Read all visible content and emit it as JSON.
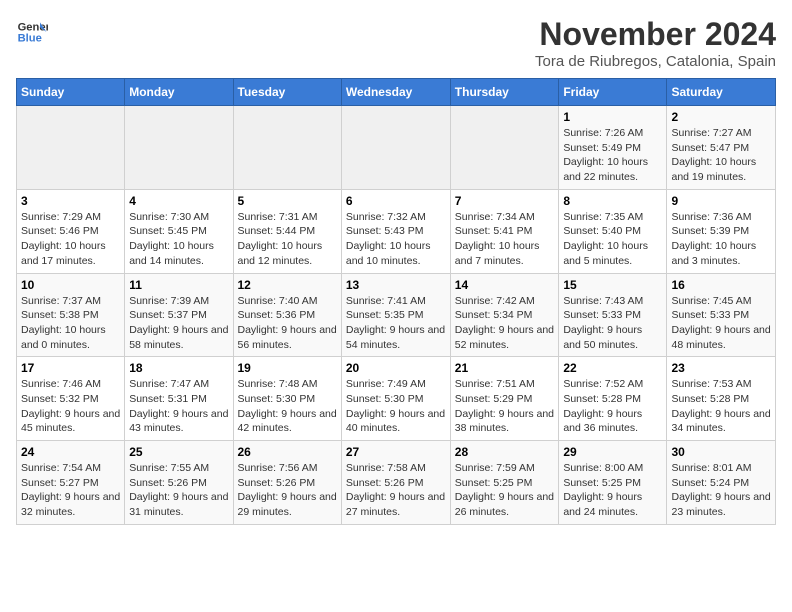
{
  "logo": {
    "line1": "General",
    "line2": "Blue"
  },
  "title": "November 2024",
  "location": "Tora de Riubregos, Catalonia, Spain",
  "weekdays": [
    "Sunday",
    "Monday",
    "Tuesday",
    "Wednesday",
    "Thursday",
    "Friday",
    "Saturday"
  ],
  "weeks": [
    [
      {
        "day": "",
        "info": ""
      },
      {
        "day": "",
        "info": ""
      },
      {
        "day": "",
        "info": ""
      },
      {
        "day": "",
        "info": ""
      },
      {
        "day": "",
        "info": ""
      },
      {
        "day": "1",
        "info": "Sunrise: 7:26 AM\nSunset: 5:49 PM\nDaylight: 10 hours and 22 minutes."
      },
      {
        "day": "2",
        "info": "Sunrise: 7:27 AM\nSunset: 5:47 PM\nDaylight: 10 hours and 19 minutes."
      }
    ],
    [
      {
        "day": "3",
        "info": "Sunrise: 7:29 AM\nSunset: 5:46 PM\nDaylight: 10 hours and 17 minutes."
      },
      {
        "day": "4",
        "info": "Sunrise: 7:30 AM\nSunset: 5:45 PM\nDaylight: 10 hours and 14 minutes."
      },
      {
        "day": "5",
        "info": "Sunrise: 7:31 AM\nSunset: 5:44 PM\nDaylight: 10 hours and 12 minutes."
      },
      {
        "day": "6",
        "info": "Sunrise: 7:32 AM\nSunset: 5:43 PM\nDaylight: 10 hours and 10 minutes."
      },
      {
        "day": "7",
        "info": "Sunrise: 7:34 AM\nSunset: 5:41 PM\nDaylight: 10 hours and 7 minutes."
      },
      {
        "day": "8",
        "info": "Sunrise: 7:35 AM\nSunset: 5:40 PM\nDaylight: 10 hours and 5 minutes."
      },
      {
        "day": "9",
        "info": "Sunrise: 7:36 AM\nSunset: 5:39 PM\nDaylight: 10 hours and 3 minutes."
      }
    ],
    [
      {
        "day": "10",
        "info": "Sunrise: 7:37 AM\nSunset: 5:38 PM\nDaylight: 10 hours and 0 minutes."
      },
      {
        "day": "11",
        "info": "Sunrise: 7:39 AM\nSunset: 5:37 PM\nDaylight: 9 hours and 58 minutes."
      },
      {
        "day": "12",
        "info": "Sunrise: 7:40 AM\nSunset: 5:36 PM\nDaylight: 9 hours and 56 minutes."
      },
      {
        "day": "13",
        "info": "Sunrise: 7:41 AM\nSunset: 5:35 PM\nDaylight: 9 hours and 54 minutes."
      },
      {
        "day": "14",
        "info": "Sunrise: 7:42 AM\nSunset: 5:34 PM\nDaylight: 9 hours and 52 minutes."
      },
      {
        "day": "15",
        "info": "Sunrise: 7:43 AM\nSunset: 5:33 PM\nDaylight: 9 hours and 50 minutes."
      },
      {
        "day": "16",
        "info": "Sunrise: 7:45 AM\nSunset: 5:33 PM\nDaylight: 9 hours and 48 minutes."
      }
    ],
    [
      {
        "day": "17",
        "info": "Sunrise: 7:46 AM\nSunset: 5:32 PM\nDaylight: 9 hours and 45 minutes."
      },
      {
        "day": "18",
        "info": "Sunrise: 7:47 AM\nSunset: 5:31 PM\nDaylight: 9 hours and 43 minutes."
      },
      {
        "day": "19",
        "info": "Sunrise: 7:48 AM\nSunset: 5:30 PM\nDaylight: 9 hours and 42 minutes."
      },
      {
        "day": "20",
        "info": "Sunrise: 7:49 AM\nSunset: 5:30 PM\nDaylight: 9 hours and 40 minutes."
      },
      {
        "day": "21",
        "info": "Sunrise: 7:51 AM\nSunset: 5:29 PM\nDaylight: 9 hours and 38 minutes."
      },
      {
        "day": "22",
        "info": "Sunrise: 7:52 AM\nSunset: 5:28 PM\nDaylight: 9 hours and 36 minutes."
      },
      {
        "day": "23",
        "info": "Sunrise: 7:53 AM\nSunset: 5:28 PM\nDaylight: 9 hours and 34 minutes."
      }
    ],
    [
      {
        "day": "24",
        "info": "Sunrise: 7:54 AM\nSunset: 5:27 PM\nDaylight: 9 hours and 32 minutes."
      },
      {
        "day": "25",
        "info": "Sunrise: 7:55 AM\nSunset: 5:26 PM\nDaylight: 9 hours and 31 minutes."
      },
      {
        "day": "26",
        "info": "Sunrise: 7:56 AM\nSunset: 5:26 PM\nDaylight: 9 hours and 29 minutes."
      },
      {
        "day": "27",
        "info": "Sunrise: 7:58 AM\nSunset: 5:26 PM\nDaylight: 9 hours and 27 minutes."
      },
      {
        "day": "28",
        "info": "Sunrise: 7:59 AM\nSunset: 5:25 PM\nDaylight: 9 hours and 26 minutes."
      },
      {
        "day": "29",
        "info": "Sunrise: 8:00 AM\nSunset: 5:25 PM\nDaylight: 9 hours and 24 minutes."
      },
      {
        "day": "30",
        "info": "Sunrise: 8:01 AM\nSunset: 5:24 PM\nDaylight: 9 hours and 23 minutes."
      }
    ]
  ]
}
